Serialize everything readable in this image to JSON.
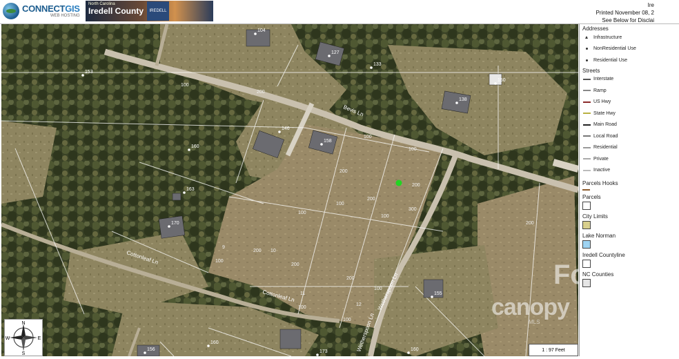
{
  "header": {
    "logo_main": "CONNECTGIS",
    "logo_sub": "WEB HOSTING",
    "county_small": "North Carolina",
    "county_name": "Iredell County",
    "seal_text": "IREDELL",
    "print_line1": "Ire",
    "print_line2": "Printed November 08, 2",
    "print_line3": "See Below for Disclai"
  },
  "legend": {
    "addresses_title": "Addresses",
    "addresses": [
      "Infrastructure",
      "NonResidential Use",
      "Residential Use"
    ],
    "streets_title": "Streets",
    "streets": [
      {
        "label": "Interstate",
        "color": "#555555"
      },
      {
        "label": "Ramp",
        "color": "#888888"
      },
      {
        "label": "US Hwy",
        "color": "#8b2a2a"
      },
      {
        "label": "State Hwy",
        "color": "#b8b040"
      },
      {
        "label": "Main Road",
        "color": "#222222"
      },
      {
        "label": "Local Road",
        "color": "#777777"
      },
      {
        "label": "Residential",
        "color": "#999999"
      },
      {
        "label": "Private",
        "color": "#aaaaaa"
      },
      {
        "label": "Inactive",
        "color": "#bbbbbb"
      }
    ],
    "parcels_hooks": {
      "label": "Parcels Hooks",
      "color": "#8b5a2b"
    },
    "layers": [
      {
        "label": "Parcels",
        "color": "#ffffff"
      },
      {
        "label": "City Limits",
        "color": "#d8cf8c"
      },
      {
        "label": "Lake Norman",
        "color": "#9fd4f2"
      },
      {
        "label": "Iredell Countyline",
        "color": "#ffffff"
      },
      {
        "label": "NC Counties",
        "color": "#e6e6e6"
      }
    ]
  },
  "map": {
    "road_labels": [
      "Bevis Ln",
      "Cottonleaf Ln",
      "Cottonleaf Ln",
      "Wetherspoon Ln",
      "Wetherspoon Ln"
    ],
    "address_labels": [
      "104",
      "127",
      "133",
      "153",
      "138",
      "146",
      "158",
      "160",
      "163",
      "170",
      "155",
      "156",
      "173",
      "150",
      "160",
      "160"
    ],
    "lot_dims": [
      "100",
      "200",
      "100",
      "200",
      "300",
      "100",
      "200",
      "200",
      "100",
      "100",
      "200",
      "200",
      "100",
      "100",
      "100",
      "100",
      "100",
      "200",
      "200"
    ],
    "lot_numbers": [
      "9",
      "10",
      "11",
      "12"
    ],
    "scale_text": "1 : 97 Feet",
    "compass": {
      "n": "N",
      "s": "S",
      "e": "E",
      "w": "W"
    }
  },
  "watermark": {
    "top": "Fo",
    "bottom": "canopy",
    "mls": "MLS"
  },
  "colors": {
    "marker": "#22d422",
    "header_blue": "#1d5d8f"
  }
}
